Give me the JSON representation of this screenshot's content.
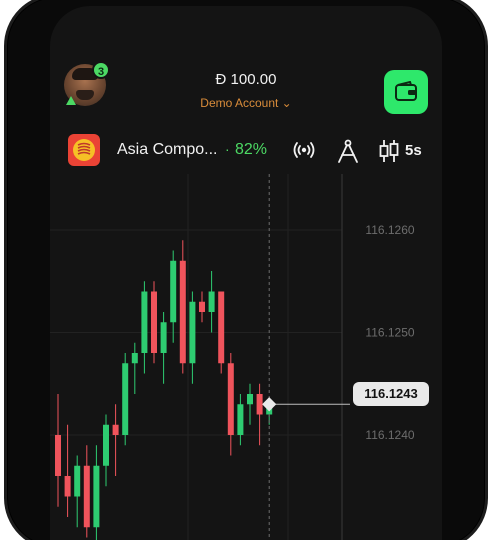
{
  "header": {
    "notification_count": "3",
    "balance": "Đ 100.00",
    "account_label": "Demo Account ⌄"
  },
  "asset": {
    "name": "Asia Compo...",
    "dot": "·",
    "payout": "82%",
    "timeframe": "5s"
  },
  "chart_data": {
    "type": "candlestick",
    "y_ticks": [
      "116.1260",
      "116.1250",
      "116.1240"
    ],
    "current_price": "116.1243",
    "colors": {
      "up": "#2ecc71",
      "down": "#f0545c"
    },
    "candles": [
      [
        116.124,
        116.1244,
        116.1233,
        116.1236
      ],
      [
        116.1236,
        116.1241,
        116.1232,
        116.1234
      ],
      [
        116.1234,
        116.1238,
        116.1231,
        116.1237
      ],
      [
        116.1237,
        116.1239,
        116.123,
        116.1231
      ],
      [
        116.1231,
        116.1239,
        116.1228,
        116.1237
      ],
      [
        116.1237,
        116.1242,
        116.1235,
        116.1241
      ],
      [
        116.1241,
        116.1243,
        116.1236,
        116.124
      ],
      [
        116.124,
        116.1248,
        116.1239,
        116.1247
      ],
      [
        116.1247,
        116.1249,
        116.1244,
        116.1248
      ],
      [
        116.1248,
        116.1255,
        116.1246,
        116.1254
      ],
      [
        116.1254,
        116.1255,
        116.1247,
        116.1248
      ],
      [
        116.1248,
        116.1252,
        116.1245,
        116.1251
      ],
      [
        116.1251,
        116.1258,
        116.1249,
        116.1257
      ],
      [
        116.1257,
        116.1259,
        116.1246,
        116.1247
      ],
      [
        116.1247,
        116.1254,
        116.1245,
        116.1253
      ],
      [
        116.1253,
        116.1254,
        116.1251,
        116.1252
      ],
      [
        116.1252,
        116.1256,
        116.125,
        116.1254
      ],
      [
        116.1254,
        116.1254,
        116.1246,
        116.1247
      ],
      [
        116.1247,
        116.1248,
        116.1238,
        116.124
      ],
      [
        116.124,
        116.1244,
        116.1239,
        116.1243
      ],
      [
        116.1243,
        116.1245,
        116.1241,
        116.1244
      ],
      [
        116.1244,
        116.1245,
        116.1239,
        116.1242
      ],
      [
        116.1242,
        116.1243,
        116.1241,
        116.1243
      ]
    ]
  }
}
